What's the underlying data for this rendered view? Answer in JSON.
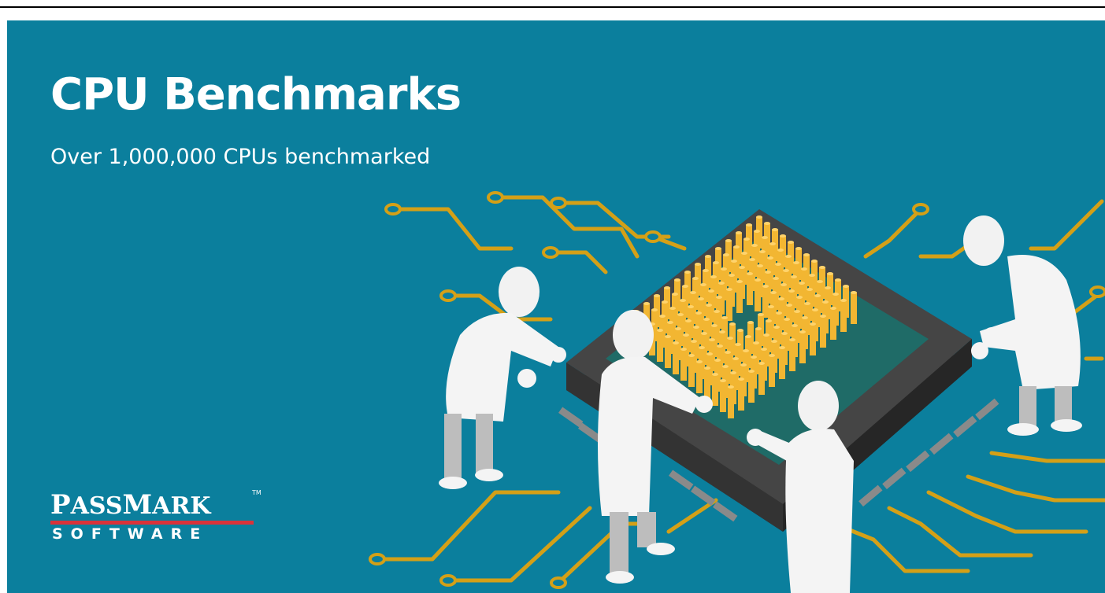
{
  "banner": {
    "title": "CPU Benchmarks",
    "subtitle": "Over 1,000,000 CPUs benchmarked",
    "background_color": "#0b7f9d"
  },
  "logo": {
    "wordmark": "PASSMARK",
    "wordmark_first_letter": "P",
    "wordmark_rest": "ASS",
    "wordmark_second_letter": "M",
    "wordmark_end": "ARK",
    "trademark": "TM",
    "tagline": "SOFTWARE",
    "accent_color": "#d9333a"
  },
  "illustration": {
    "subject": "cpu-chip-with-technicians",
    "trace_color": "#d4a017",
    "pin_color": "#f2b632",
    "chip_color": "#3d3d3d"
  }
}
